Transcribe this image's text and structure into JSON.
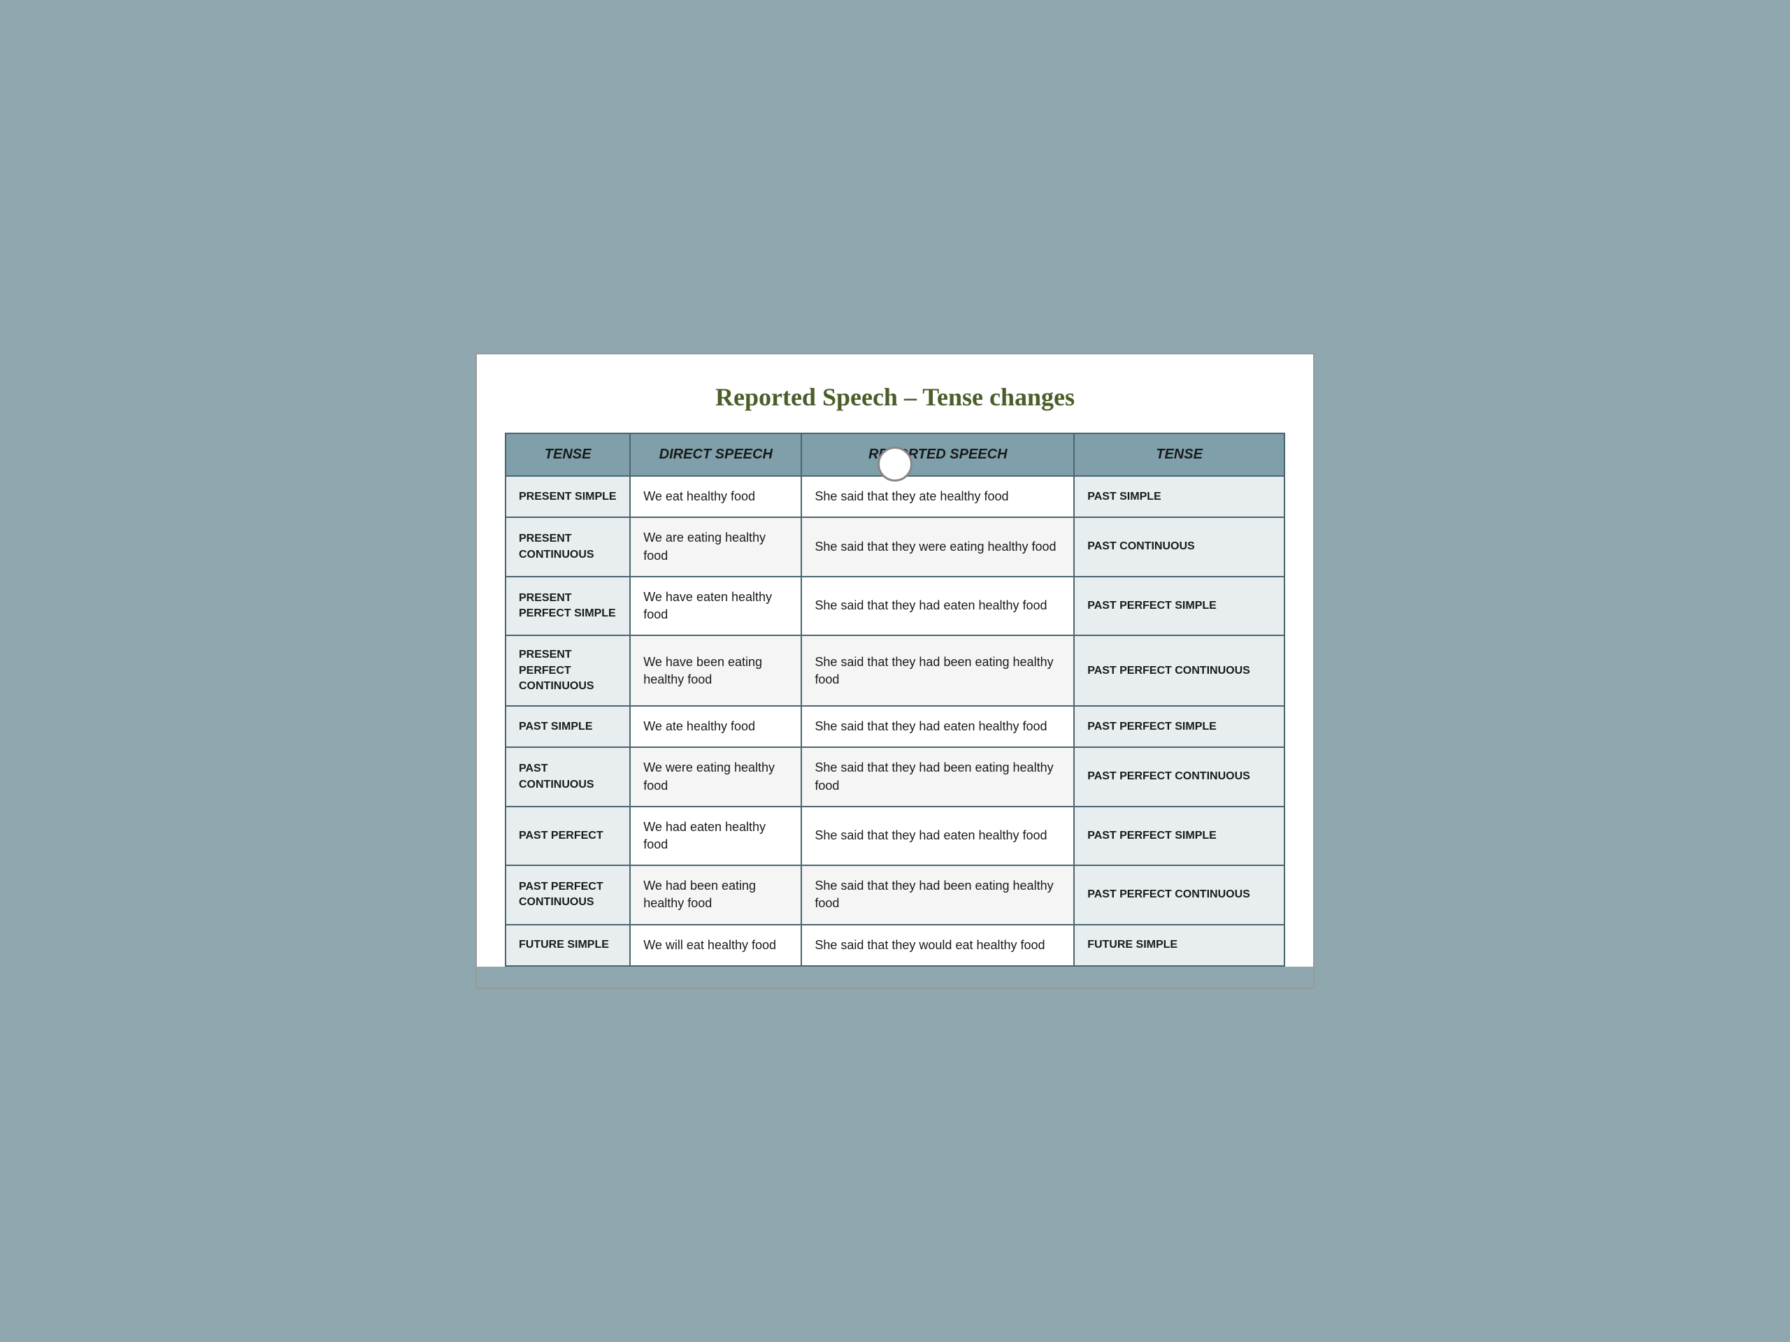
{
  "title": "Reported Speech – Tense changes",
  "headers": {
    "col1": "TENSE",
    "col2": "DIRECT SPEECH",
    "col3": "REPORTED SPEECH",
    "col4": "TENSE"
  },
  "rows": [
    {
      "tense": "PRESENT SIMPLE",
      "direct": "We eat healthy food",
      "reported": "She said that they ate healthy food",
      "result_tense": "PAST SIMPLE"
    },
    {
      "tense": "PRESENT CONTINUOUS",
      "direct": "We are eating healthy food",
      "reported": "She said that they were eating healthy food",
      "result_tense": "PAST CONTINUOUS"
    },
    {
      "tense": "PRESENT PERFECT SIMPLE",
      "direct": "We have eaten healthy food",
      "reported": "She said that they had eaten healthy food",
      "result_tense": "PAST PERFECT SIMPLE"
    },
    {
      "tense": "PRESENT PERFECT CONTINUOUS",
      "direct": "We have been eating healthy food",
      "reported": "She said that they had been eating  healthy food",
      "result_tense": "PAST PERFECT CONTINUOUS"
    },
    {
      "tense": "PAST SIMPLE",
      "direct": "We ate healthy food",
      "reported": "She said that they had eaten healthy food",
      "result_tense": "PAST PERFECT SIMPLE"
    },
    {
      "tense": "PAST CONTINUOUS",
      "direct": "We were eating healthy food",
      "reported": "She said that they had been eating healthy food",
      "result_tense": "PAST PERFECT CONTINUOUS"
    },
    {
      "tense": "PAST PERFECT",
      "direct": "We had eaten healthy food",
      "reported": "She said that they had eaten healthy food",
      "result_tense": "PAST PERFECT SIMPLE"
    },
    {
      "tense": "PAST PERFECT CONTINUOUS",
      "direct": "We had been eating healthy food",
      "reported": "She said that they had been eating  healthy food",
      "result_tense": "PAST PERFECT CONTINUOUS"
    },
    {
      "tense": "FUTURE SIMPLE",
      "direct": "We will eat healthy food",
      "reported": "She said that they would eat healthy food",
      "result_tense": "FUTURE SIMPLE"
    }
  ]
}
